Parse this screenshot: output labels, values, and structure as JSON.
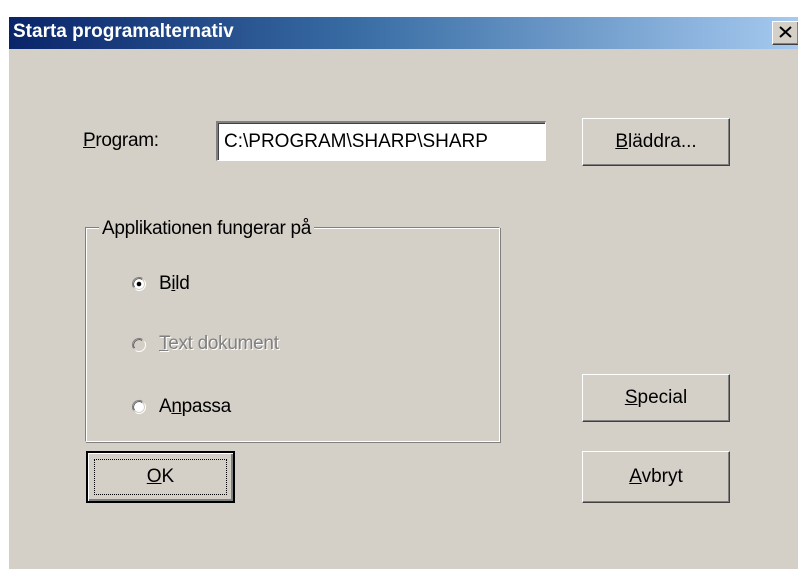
{
  "window": {
    "title": "Starta programalternativ",
    "close_icon": "close-icon"
  },
  "program": {
    "label_mnemonic": "P",
    "label_rest": "rogram:",
    "value": "C:\\PROGRAM\\SHARP\\SHARP"
  },
  "buttons": {
    "browse_mnemonic": "B",
    "browse_rest": "läddra...",
    "special_mnemonic": "S",
    "special_rest": "pecial",
    "ok_mnemonic": "O",
    "ok_rest": "K",
    "cancel_mnemonic": "A",
    "cancel_rest": "vbryt"
  },
  "group": {
    "title": "Applikationen fungerar på",
    "options": [
      {
        "pre": "B",
        "mnemonic": "i",
        "post": "ld",
        "selected": true,
        "enabled": true
      },
      {
        "pre": "",
        "mnemonic": "T",
        "post": "ext dokument",
        "selected": false,
        "enabled": false
      },
      {
        "pre": "A",
        "mnemonic": "n",
        "post": "passa",
        "selected": false,
        "enabled": true
      }
    ]
  },
  "colors": {
    "face": "#d4d0c8",
    "title_start": "#0a246a",
    "title_end": "#a6caf0",
    "disabled_text": "#808080"
  }
}
